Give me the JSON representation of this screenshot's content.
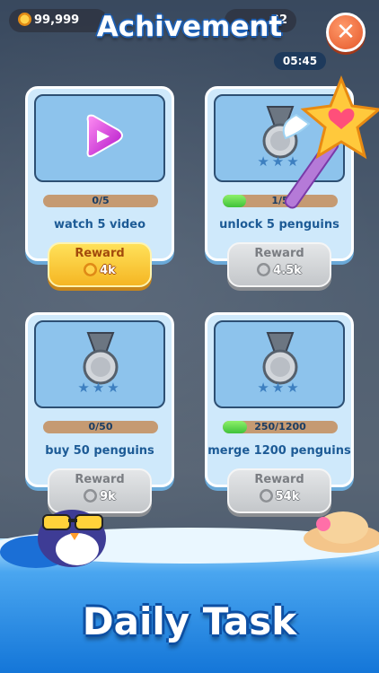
{
  "hud": {
    "coins": "99,999",
    "level": "32",
    "timer": "05:45"
  },
  "header": {
    "title": "Achivement",
    "close_glyph": "✕"
  },
  "cards": [
    {
      "task": "watch 5 video",
      "progress_text": "0/5",
      "progress": 0.0,
      "reward_label": "Reward",
      "reward_amount": "4k",
      "claimable": true,
      "icon": "play-gem-icon",
      "stars": ""
    },
    {
      "task": "unlock 5 penguins",
      "progress_text": "1/5",
      "progress": 0.2,
      "reward_label": "Reward",
      "reward_amount": "4.5k",
      "claimable": false,
      "icon": "silver-medal-icon",
      "stars": "★★★"
    },
    {
      "task": "buy 50 penguins",
      "progress_text": "0/50",
      "progress": 0.0,
      "reward_label": "Reward",
      "reward_amount": "9k",
      "claimable": false,
      "icon": "silver-medal-icon",
      "stars": "★★★"
    },
    {
      "task": "merge 1200 penguins",
      "progress_text": "250/1200",
      "progress": 0.208,
      "reward_label": "Reward",
      "reward_amount": "54k",
      "claimable": false,
      "icon": "silver-medal-icon",
      "stars": "★★★"
    }
  ],
  "footer": {
    "title": "Daily Task"
  },
  "colors": {
    "accent": "#1d5fb3",
    "card": "#cfe9fb",
    "reward_gold": "#f5b623",
    "reward_grey": "#c4c7ca"
  }
}
